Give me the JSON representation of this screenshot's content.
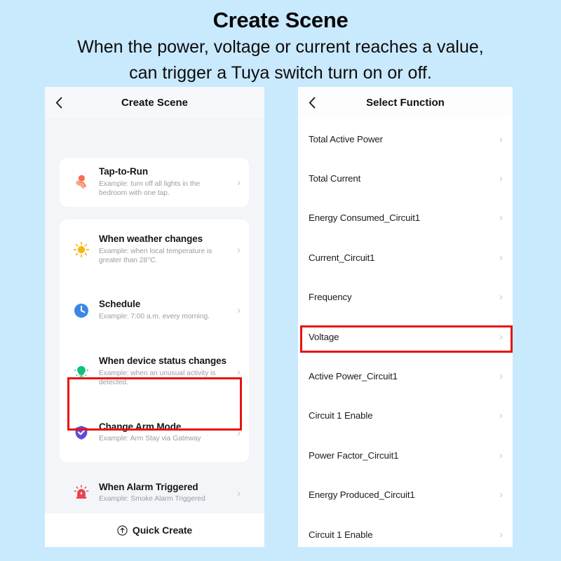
{
  "header": {
    "title": "Create Scene",
    "subtitle_line1": "When the power, voltage or current reaches a value,",
    "subtitle_line2": "can trigger a Tuya switch turn on or off."
  },
  "colors": {
    "page_background": "#c9e9fd",
    "panel_background": "#f4f5f9",
    "card_background": "#ffffff",
    "highlight_red": "#e8140f",
    "chevron_gray": "#c8c8ce",
    "title_text": "#16161a",
    "desc_text": "#9c9ca5",
    "icon_tap_to_run": "#f4704f",
    "icon_weather": "#fbb516",
    "icon_schedule": "#3b87e8",
    "icon_device_status": "#11c07a",
    "icon_arm_mode": "#5b4ddb",
    "icon_alarm": "#e8404a"
  },
  "left_panel": {
    "nav": {
      "back_icon": "chevron-left-icon",
      "title": "Create Scene"
    },
    "scenes": [
      {
        "icon": "tap-hand-icon",
        "title": "Tap-to-Run",
        "desc": "Example: turn off all lights in the bedroom with one tap.",
        "chevron": "›",
        "highlighted": false
      },
      {
        "icon": "sun-icon",
        "title": "When weather changes",
        "desc": "Example: when local temperature is greater than 28°C.",
        "chevron": "›",
        "highlighted": false
      },
      {
        "icon": "clock-icon",
        "title": "Schedule",
        "desc": "Example: 7:00 a.m. every morning.",
        "chevron": "›",
        "highlighted": false
      },
      {
        "icon": "device-bulb-icon",
        "title": "When device status changes",
        "desc": "Example: when an unusual activity is detected.",
        "chevron": "›",
        "highlighted": true
      },
      {
        "icon": "shield-check-icon",
        "title": "Change Arm Mode",
        "desc": "Example: Arm Stay via Gateway",
        "chevron": "›",
        "highlighted": false
      },
      {
        "icon": "alarm-siren-icon",
        "title": "When Alarm Triggered",
        "desc": "Example: Smoke Alarm Triggered",
        "chevron": "›",
        "highlighted": false
      }
    ],
    "quick_create": {
      "icon": "arrow-up-circle-icon",
      "label": "Quick Create"
    }
  },
  "right_panel": {
    "nav": {
      "back_icon": "chevron-left-icon",
      "title": "Select Function"
    },
    "functions": [
      {
        "label": "Total Active Power",
        "chevron": "›",
        "highlighted": false
      },
      {
        "label": "Total Current",
        "chevron": "›",
        "highlighted": false
      },
      {
        "label": "Energy Consumed_Circuit1",
        "chevron": "›",
        "highlighted": false
      },
      {
        "label": "Current_Circuit1",
        "chevron": "›",
        "highlighted": true
      },
      {
        "label": "Frequency",
        "chevron": "›",
        "highlighted": false
      },
      {
        "label": "Voltage",
        "chevron": "›",
        "highlighted": false
      },
      {
        "label": "Active Power_Circuit1",
        "chevron": "›",
        "highlighted": false
      },
      {
        "label": "Circuit 1 Enable",
        "chevron": "›",
        "highlighted": false
      },
      {
        "label": "Power Factor_Circuit1",
        "chevron": "›",
        "highlighted": false
      },
      {
        "label": "Energy Produced_Circuit1",
        "chevron": "›",
        "highlighted": false
      },
      {
        "label": "Circuit 1 Enable",
        "chevron": "›",
        "highlighted": false
      }
    ]
  }
}
